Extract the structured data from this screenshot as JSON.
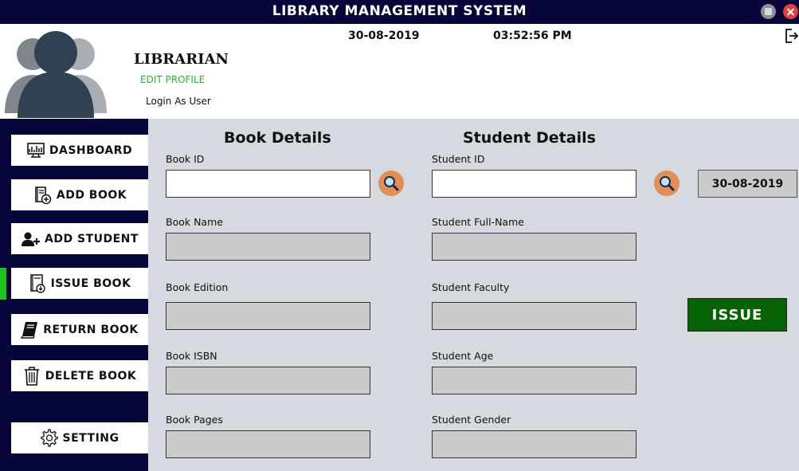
{
  "window": {
    "title": "LIBRARY MANAGEMENT SYSTEM"
  },
  "header": {
    "role": "LIBRARIAN",
    "edit_profile": "EDIT PROFILE",
    "login_as": "Login As User",
    "date": "30-08-2019",
    "time": "03:52:56 PM"
  },
  "sidebar": {
    "items": [
      {
        "label": "DASHBOARD",
        "icon": "monitor-icon"
      },
      {
        "label": "ADD BOOK",
        "icon": "add-book-icon"
      },
      {
        "label": "ADD STUDENT",
        "icon": "add-user-icon"
      },
      {
        "label": "ISSUE BOOK",
        "icon": "issue-book-icon",
        "active": true
      },
      {
        "label": "RETURN BOOK",
        "icon": "book-icon"
      },
      {
        "label": "DELETE BOOK",
        "icon": "trash-icon"
      },
      {
        "label": "SETTING",
        "icon": "gear-icon"
      }
    ]
  },
  "book_details": {
    "title": "Book Details",
    "book_id": {
      "label": "Book ID",
      "value": ""
    },
    "book_name": {
      "label": "Book Name",
      "value": ""
    },
    "book_edition": {
      "label": "Book Edition",
      "value": ""
    },
    "book_isbn": {
      "label": "Book ISBN",
      "value": ""
    },
    "book_pages": {
      "label": "Book Pages",
      "value": ""
    }
  },
  "student_details": {
    "title": "Student Details",
    "student_id": {
      "label": "Student ID",
      "value": ""
    },
    "full_name": {
      "label": "Student Full-Name",
      "value": ""
    },
    "faculty": {
      "label": "Student Faculty",
      "value": ""
    },
    "age": {
      "label": "Student Age",
      "value": ""
    },
    "gender": {
      "label": "Student Gender",
      "value": ""
    }
  },
  "issue_date": "30-08-2019",
  "issue_button": "ISSUE",
  "colors": {
    "navy": "#06063a",
    "accent_green": "#1ec21e",
    "issue_green": "#056305",
    "search_orange": "#e08f55",
    "content_bg": "#d6d9e0"
  }
}
